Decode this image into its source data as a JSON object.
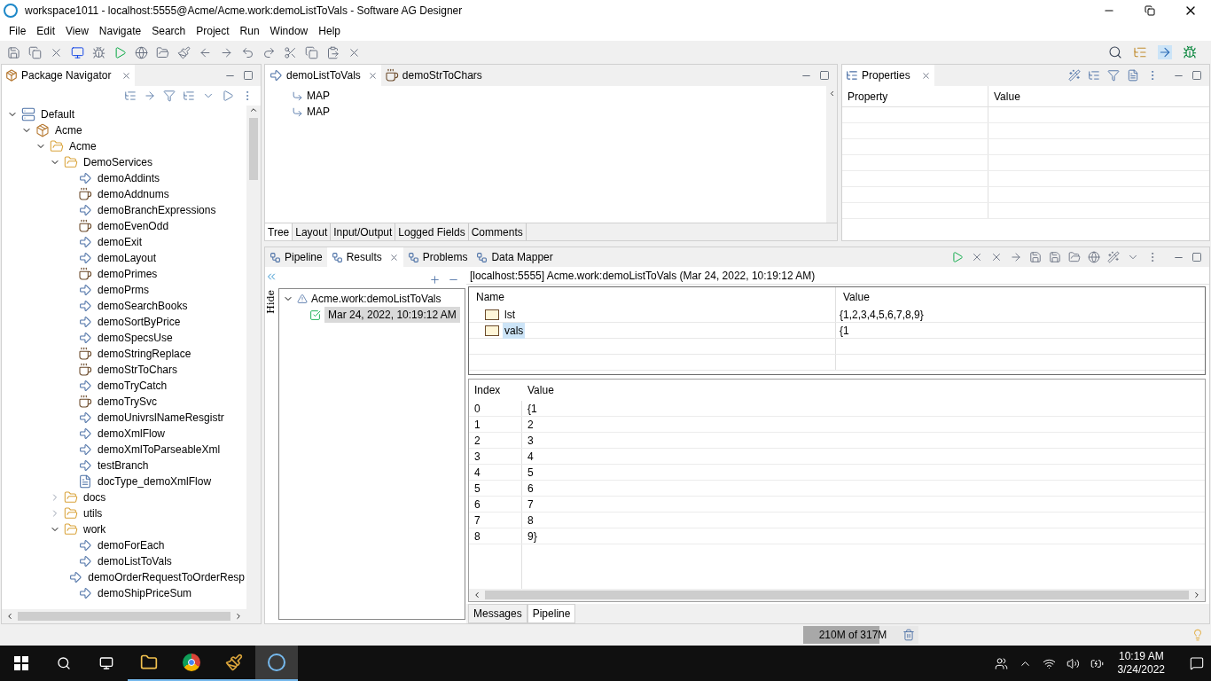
{
  "window": {
    "title": "workspace1011 - localhost:5555@Acme/Acme.work:demoListToVals - Software AG Designer"
  },
  "menu": [
    "File",
    "Edit",
    "View",
    "Navigate",
    "Search",
    "Project",
    "Run",
    "Window",
    "Help"
  ],
  "navigator": {
    "title": "Package Navigator",
    "tree": [
      {
        "label": "Default",
        "kind": "server",
        "expanded": true,
        "children": [
          {
            "label": "Acme",
            "kind": "package",
            "expanded": true,
            "children": [
              {
                "label": "Acme",
                "kind": "folder",
                "expanded": true,
                "children": [
                  {
                    "label": "DemoServices",
                    "kind": "folder",
                    "expanded": true,
                    "children": [
                      {
                        "label": "demoAddints",
                        "kind": "flow"
                      },
                      {
                        "label": "demoAddnums",
                        "kind": "java"
                      },
                      {
                        "label": "demoBranchExpressions",
                        "kind": "flow"
                      },
                      {
                        "label": "demoEvenOdd",
                        "kind": "java"
                      },
                      {
                        "label": "demoExit",
                        "kind": "flow"
                      },
                      {
                        "label": "demoLayout",
                        "kind": "flow"
                      },
                      {
                        "label": "demoPrimes",
                        "kind": "java"
                      },
                      {
                        "label": "demoPrms",
                        "kind": "flow"
                      },
                      {
                        "label": "demoSearchBooks",
                        "kind": "flow"
                      },
                      {
                        "label": "demoSortByPrice",
                        "kind": "flow"
                      },
                      {
                        "label": "demoSpecsUse",
                        "kind": "flow"
                      },
                      {
                        "label": "demoStringReplace",
                        "kind": "java"
                      },
                      {
                        "label": "demoStrToChars",
                        "kind": "java"
                      },
                      {
                        "label": "demoTryCatch",
                        "kind": "flow"
                      },
                      {
                        "label": "demoTrySvc",
                        "kind": "java"
                      },
                      {
                        "label": "demoUnivrslNameResgistr",
                        "kind": "flow"
                      },
                      {
                        "label": "demoXmlFlow",
                        "kind": "flow"
                      },
                      {
                        "label": "demoXmlToParseableXml",
                        "kind": "flow"
                      },
                      {
                        "label": "testBranch",
                        "kind": "flow"
                      },
                      {
                        "label": "docType_demoXmlFlow",
                        "kind": "doc"
                      }
                    ]
                  },
                  {
                    "label": "docs",
                    "kind": "folder",
                    "expanded": false
                  },
                  {
                    "label": "utils",
                    "kind": "folder",
                    "expanded": false
                  },
                  {
                    "label": "work",
                    "kind": "folder",
                    "expanded": true,
                    "children": [
                      {
                        "label": "demoForEach",
                        "kind": "flow"
                      },
                      {
                        "label": "demoListToVals",
                        "kind": "flow"
                      },
                      {
                        "label": "demoOrderRequestToOrderResp",
                        "kind": "flow"
                      },
                      {
                        "label": "demoShipPriceSum",
                        "kind": "flow"
                      }
                    ]
                  }
                ]
              }
            ]
          }
        ]
      }
    ]
  },
  "editor": {
    "tabs": [
      {
        "label": "demoListToVals",
        "kind": "flow",
        "selected": true
      },
      {
        "label": "demoStrToChars",
        "kind": "java",
        "selected": false
      }
    ],
    "steps": [
      "MAP",
      "MAP"
    ],
    "bottom_tabs": [
      {
        "label": "Tree",
        "selected": true
      },
      {
        "label": "Layout",
        "selected": false
      },
      {
        "label": "Input/Output",
        "selected": false
      },
      {
        "label": "Logged Fields",
        "selected": false
      },
      {
        "label": "Comments",
        "selected": false
      }
    ]
  },
  "properties": {
    "title": "Properties",
    "columns": [
      "Property",
      "Value"
    ]
  },
  "views": {
    "tabs": [
      {
        "label": "Pipeline",
        "selected": false
      },
      {
        "label": "Results",
        "selected": true
      },
      {
        "label": "Problems",
        "selected": false
      },
      {
        "label": "Data Mapper",
        "selected": false
      }
    ],
    "hide_label": "Hide",
    "results_tree": {
      "label": "Acme.work:demoListToVals",
      "expanded": true,
      "children": [
        {
          "label": "Mar 24, 2022, 10:19:12 AM",
          "selected": true
        }
      ]
    },
    "header": "[localhost:5555] Acme.work:demoListToVals (Mar 24, 2022, 10:19:12 AM)",
    "pipeline": {
      "columns": [
        "Name",
        "Value"
      ],
      "rows": [
        {
          "name": "lst",
          "value": "{1,2,3,4,5,6,7,8,9}",
          "selected": false
        },
        {
          "name": "vals",
          "value": "{1",
          "selected": true
        }
      ]
    },
    "index_table": {
      "columns": [
        "Index",
        "Value"
      ],
      "rows": [
        [
          "0",
          "{1"
        ],
        [
          "1",
          "2"
        ],
        [
          "2",
          "3"
        ],
        [
          "3",
          "4"
        ],
        [
          "4",
          "5"
        ],
        [
          "5",
          "6"
        ],
        [
          "6",
          "7"
        ],
        [
          "7",
          "8"
        ],
        [
          "8",
          "9}"
        ]
      ]
    },
    "bottom_tabs": [
      {
        "label": "Messages",
        "selected": false
      },
      {
        "label": "Pipeline",
        "selected": true
      }
    ]
  },
  "status_bar": {
    "memory": "210M of 317M",
    "level": 0.66
  },
  "taskbar": {
    "time": "10:19 AM",
    "date": "3/24/2022"
  }
}
